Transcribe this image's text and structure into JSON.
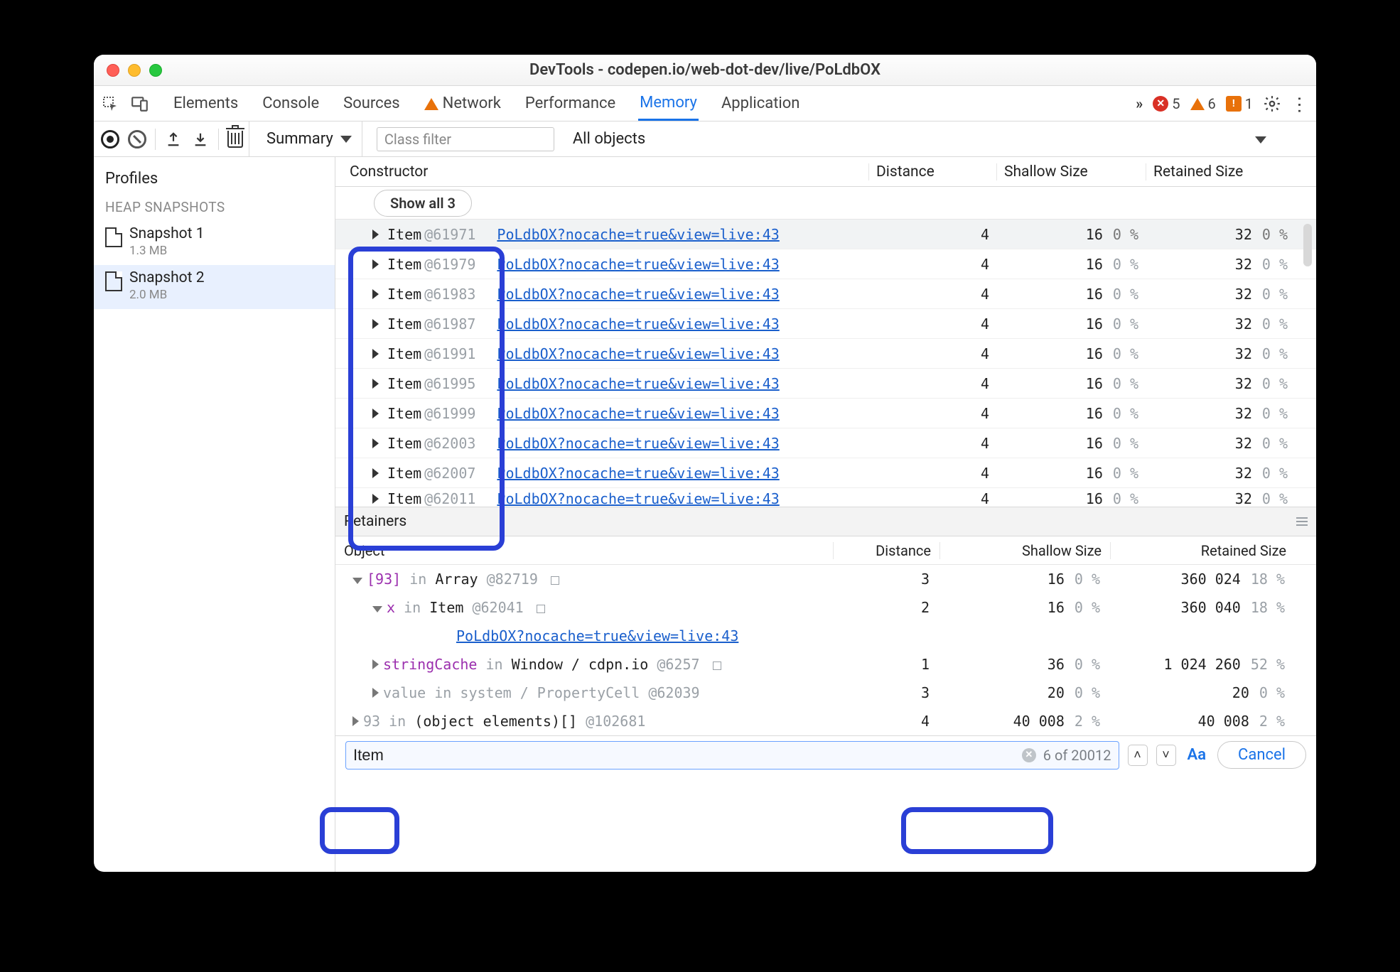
{
  "title": "DevTools - codepen.io/web-dot-dev/live/PoLdbOX",
  "tabs": [
    "Elements",
    "Console",
    "Sources",
    "Network",
    "Performance",
    "Memory",
    "Application"
  ],
  "active_tab": "Memory",
  "warning_tab_index": 3,
  "status": {
    "errors": 5,
    "warnings": 6,
    "issues": 1
  },
  "subbar": {
    "summary": "Summary",
    "classfilter_placeholder": "Class filter",
    "allobjects": "All objects"
  },
  "sidebar": {
    "title": "Profiles",
    "category": "HEAP SNAPSHOTS",
    "snapshots": [
      {
        "name": "Snapshot 1",
        "size": "1.3 MB",
        "selected": false
      },
      {
        "name": "Snapshot 2",
        "size": "2.0 MB",
        "selected": true
      }
    ]
  },
  "grid": {
    "cols": [
      "Constructor",
      "Distance",
      "Shallow Size",
      "Retained Size"
    ],
    "show_all": "Show all 3",
    "link": "PoLdbOX?nocache=true&view=live:43",
    "rows": [
      {
        "name": "Item",
        "id": "@61971",
        "dist": 4,
        "sh": 16,
        "shp": "0 %",
        "rt": 32,
        "rtp": "0 %",
        "sel": true
      },
      {
        "name": "Item",
        "id": "@61979",
        "dist": 4,
        "sh": 16,
        "shp": "0 %",
        "rt": 32,
        "rtp": "0 %"
      },
      {
        "name": "Item",
        "id": "@61983",
        "dist": 4,
        "sh": 16,
        "shp": "0 %",
        "rt": 32,
        "rtp": "0 %"
      },
      {
        "name": "Item",
        "id": "@61987",
        "dist": 4,
        "sh": 16,
        "shp": "0 %",
        "rt": 32,
        "rtp": "0 %"
      },
      {
        "name": "Item",
        "id": "@61991",
        "dist": 4,
        "sh": 16,
        "shp": "0 %",
        "rt": 32,
        "rtp": "0 %"
      },
      {
        "name": "Item",
        "id": "@61995",
        "dist": 4,
        "sh": 16,
        "shp": "0 %",
        "rt": 32,
        "rtp": "0 %"
      },
      {
        "name": "Item",
        "id": "@61999",
        "dist": 4,
        "sh": 16,
        "shp": "0 %",
        "rt": 32,
        "rtp": "0 %"
      },
      {
        "name": "Item",
        "id": "@62003",
        "dist": 4,
        "sh": 16,
        "shp": "0 %",
        "rt": 32,
        "rtp": "0 %"
      },
      {
        "name": "Item",
        "id": "@62007",
        "dist": 4,
        "sh": 16,
        "shp": "0 %",
        "rt": 32,
        "rtp": "0 %"
      },
      {
        "name": "Item",
        "id": "@62011",
        "dist": 4,
        "sh": 16,
        "shp": "0 %",
        "rt": 32,
        "rtp": "0 %"
      }
    ]
  },
  "retainers": {
    "title": "Retainers",
    "cols": [
      "Object",
      "Distance",
      "Shallow Size",
      "Retained Size"
    ],
    "link": "PoLdbOX?nocache=true&view=live:43",
    "rows": [
      {
        "indent": 1,
        "arrow": "down",
        "html": "<span class='kw-idx'>[93]</span> <span class='kw-in'>in</span> <span class='kw-type'>Array</span> <span class='kw-id'>@82719</span> <span class='sq'></span>",
        "dist": 3,
        "sh": "16",
        "shp": "0 %",
        "rt": "360 024",
        "rtp": "18 %"
      },
      {
        "indent": 2,
        "arrow": "down",
        "html": "<span class='kw-prop'>x</span> <span class='kw-in'>in</span> <span class='kw-type'>Item</span> <span class='kw-id'>@62041</span> <span class='sq'></span>",
        "dist": 2,
        "sh": "16",
        "shp": "0 %",
        "rt": "360 040",
        "rtp": "18 %"
      },
      {
        "indent": 3,
        "arrow": "",
        "link": true,
        "dist": "",
        "sh": "",
        "shp": "",
        "rt": "",
        "rtp": ""
      },
      {
        "indent": 2,
        "arrow": "right",
        "html": "<span class='kw-prop'>stringCache</span> <span class='kw-in'>in</span> <span class='kw-type'>Window / cdpn.io</span> <span class='kw-id'>@6257</span> <span class='sq'></span>",
        "dist": 1,
        "sh": "36",
        "shp": "0 %",
        "rt": "1 024 260",
        "rtp": "52 %"
      },
      {
        "indent": 2,
        "arrow": "right",
        "html": "<span class='kw-gray'>value</span> <span class='kw-gray'>in</span> <span class='kw-gray'>system / PropertyCell</span> <span class='kw-gray'>@62039</span>",
        "dist": 3,
        "sh": "20",
        "shp": "0 %",
        "rt": "20",
        "rtp": "0 %"
      },
      {
        "indent": 1,
        "arrow": "right",
        "html": "<span class='kw-gray'>93</span> <span class='kw-in'>in</span> <span class='kw-type'>(object elements)[]</span> <span class='kw-id'>@102681</span>",
        "dist": 4,
        "sh": "40 008",
        "shp": "2 %",
        "rt": "40 008",
        "rtp": "2 %"
      }
    ]
  },
  "search": {
    "value": "Item",
    "count": "6 of 20012",
    "aa": "Aa",
    "cancel": "Cancel"
  }
}
